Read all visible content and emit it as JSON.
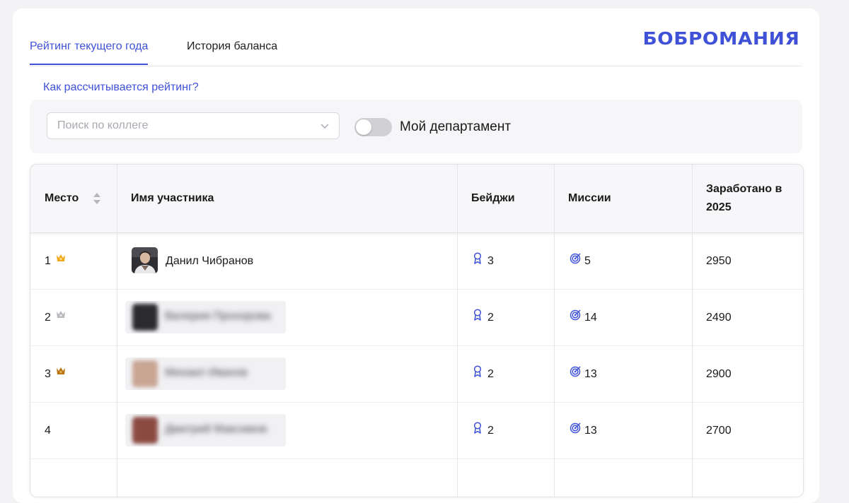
{
  "tabs": [
    {
      "label": "Рейтинг текущего года",
      "active": true
    },
    {
      "label": "История баланса",
      "active": false
    }
  ],
  "brand": {
    "logo_text": "БОБРОМАНИЯ",
    "accent_color": "#3f51d6"
  },
  "rating_help_link": "Как рассчитывается рейтинг?",
  "filters": {
    "search_placeholder": "Поиск по коллеге",
    "search_value": "",
    "toggle_label": "Мой департамент",
    "toggle_on": false
  },
  "table": {
    "columns": {
      "place": "Место",
      "name": "Имя участника",
      "badges": "Бейджи",
      "missions": "Миссии",
      "earned_line1": "Заработано в",
      "earned_line2": "2025"
    },
    "rows": [
      {
        "place": "1",
        "crown": "gold",
        "name": "Данил Чибранов",
        "blurred": false,
        "badges": "3",
        "missions": "5",
        "earned": "2950"
      },
      {
        "place": "2",
        "crown": "silver",
        "name": "Валерия Прохорова",
        "blurred": true,
        "badges": "2",
        "missions": "14",
        "earned": "2490"
      },
      {
        "place": "3",
        "crown": "bronze",
        "name": "Михаил Иванов",
        "blurred": true,
        "badges": "2",
        "missions": "13",
        "earned": "2900"
      },
      {
        "place": "4",
        "crown": "none",
        "name": "Дмитрий Максимов",
        "blurred": true,
        "badges": "2",
        "missions": "13",
        "earned": "2700"
      }
    ]
  },
  "icons": {
    "crown": "crown-icon",
    "badge": "award-ribbon-icon",
    "mission": "target-icon",
    "sort": "sort-icon",
    "chevron": "chevron-down-icon"
  },
  "colors": {
    "gold": "#f2a81d",
    "silver": "#b9b9bf",
    "bronze": "#b9770e",
    "icon_blue": "#3f51d6"
  }
}
